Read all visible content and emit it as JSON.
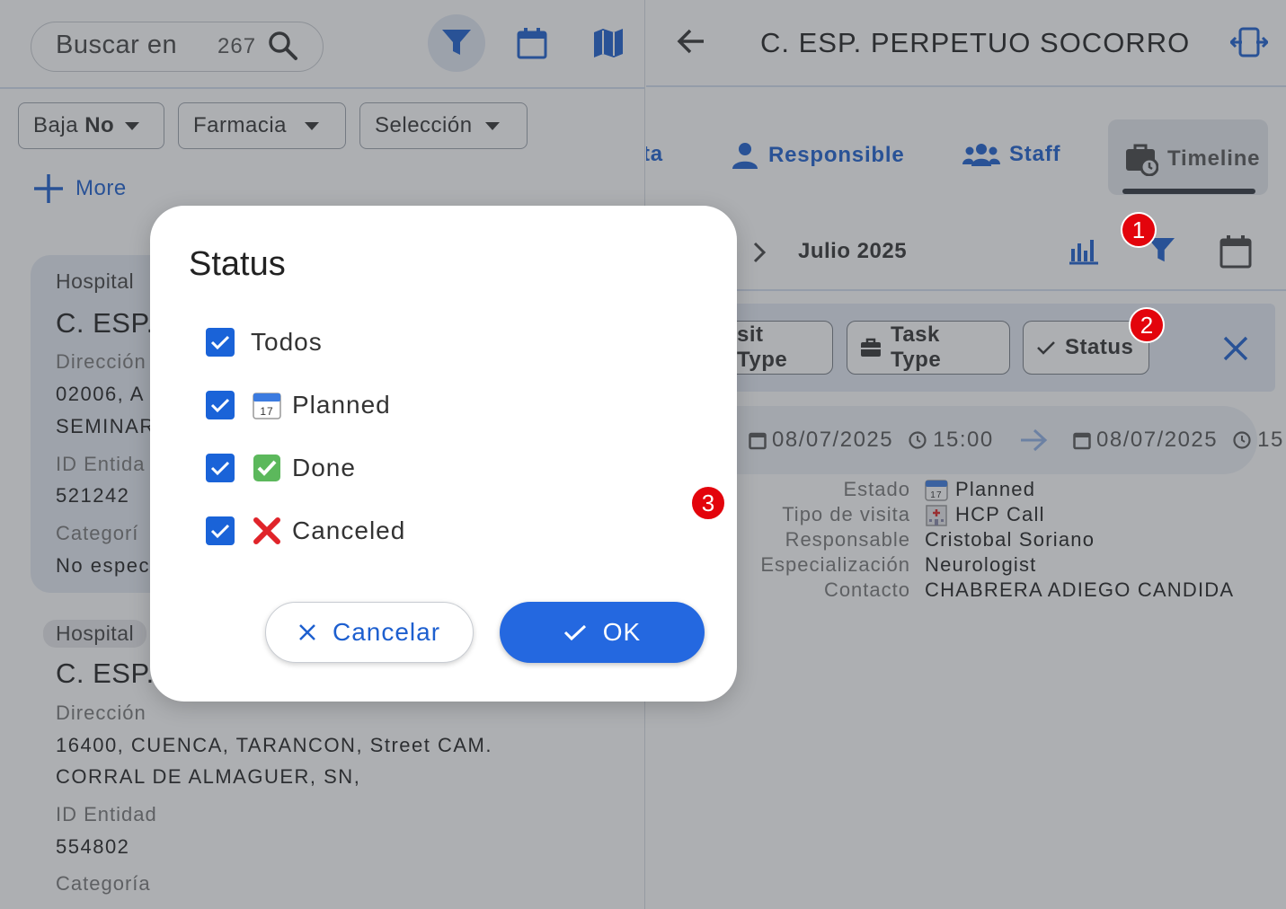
{
  "left": {
    "search": {
      "label": "Buscar en",
      "count": "267"
    },
    "chips": [
      {
        "prefix": "Baja",
        "value": "No"
      },
      {
        "prefix": "",
        "value": "Farmacia"
      },
      {
        "prefix": "",
        "value": "Selección"
      }
    ],
    "more_label": "More",
    "cards": [
      {
        "badge": "Hospital",
        "title": "C. ESP.",
        "address_label": "Dirección",
        "address_line1": "02006, A",
        "address_line2": "SEMINAR",
        "id_label": "ID Entida",
        "id_value": "521242",
        "category_label": "Categorí",
        "category_value": "No espec"
      },
      {
        "badge": "Hospital",
        "title": "C. ESP.",
        "address_label": "Dirección",
        "address_line1": "16400, CUENCA, TARANCON, Street CAM.",
        "address_line2": "CORRAL DE ALMAGUER, SN,",
        "id_label": "ID Entidad",
        "id_value": "554802",
        "category_label": "Categoría"
      }
    ]
  },
  "right": {
    "title": "C. ESP. PERPETUO SOCORRO",
    "tabs": [
      {
        "label": "ta"
      },
      {
        "label": "Responsible"
      },
      {
        "label": "Staff"
      },
      {
        "label": "Timeline"
      }
    ],
    "month": "Julio 2025",
    "filter_chips": [
      {
        "label": "sit Type"
      },
      {
        "label": "Task Type"
      },
      {
        "label": "Status"
      }
    ],
    "event": {
      "start_date": "08/07/2025",
      "start_time": "15:00",
      "end_date": "08/07/2025",
      "end_time": "15"
    },
    "details": [
      {
        "label": "Estado",
        "value": "Planned"
      },
      {
        "label": "Tipo de visita",
        "value": "HCP Call"
      },
      {
        "label": "Responsable",
        "value": "Cristobal Soriano"
      },
      {
        "label": "Especialización",
        "value": "Neurologist"
      },
      {
        "label": "Contacto",
        "value": "CHABRERA ADIEGO CANDIDA"
      }
    ]
  },
  "dialog": {
    "title": "Status",
    "options": [
      {
        "label": "Todos",
        "checked": true
      },
      {
        "label": "Planned",
        "checked": true,
        "icon": "calendar-emoji"
      },
      {
        "label": "Done",
        "checked": true,
        "icon": "check-mark-button-emoji"
      },
      {
        "label": "Canceled",
        "checked": true,
        "icon": "cross-mark-emoji"
      }
    ],
    "cancel_label": "Cancelar",
    "ok_label": "OK"
  },
  "markers": [
    "1",
    "2",
    "3"
  ],
  "colors": {
    "primary": "#1d5fcf",
    "ok_button": "#2468e0",
    "checkbox": "#1a63d8",
    "marker": "#e3040c"
  }
}
